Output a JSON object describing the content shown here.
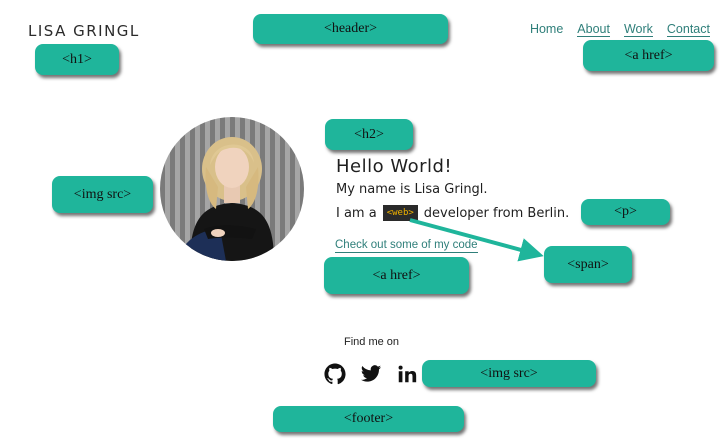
{
  "brand": "LISA GRINGL",
  "nav": [
    {
      "label": "Home",
      "underlined": false
    },
    {
      "label": "About",
      "underlined": true
    },
    {
      "label": "Work",
      "underlined": true
    },
    {
      "label": "Contact",
      "underlined": true
    }
  ],
  "intro": {
    "greeting": "Hello World!",
    "line1": "My name is Lisa Gringl.",
    "line2_pre": "I am a",
    "chip": "<web>",
    "line2_post": "developer from Berlin.",
    "code_link": "Check out some of my code"
  },
  "footer": {
    "find_me": "Find me on",
    "social": [
      "github-icon",
      "twitter-icon",
      "linkedin-icon"
    ]
  },
  "annotations": {
    "header": "<header>",
    "h1": "<h1>",
    "a_href_nav": "<a href>",
    "h2": "<h2>",
    "img_src_avatar": "<img src>",
    "p": "<p>",
    "span": "<span>",
    "a_href_code": "<a href>",
    "img_src_social": "<img src>",
    "footer": "<footer>"
  },
  "colors": {
    "accent": "#2f7f7a",
    "annotation": "#1fb59b",
    "chip_bg": "#2a2a2a",
    "chip_text": "#f0b200"
  }
}
